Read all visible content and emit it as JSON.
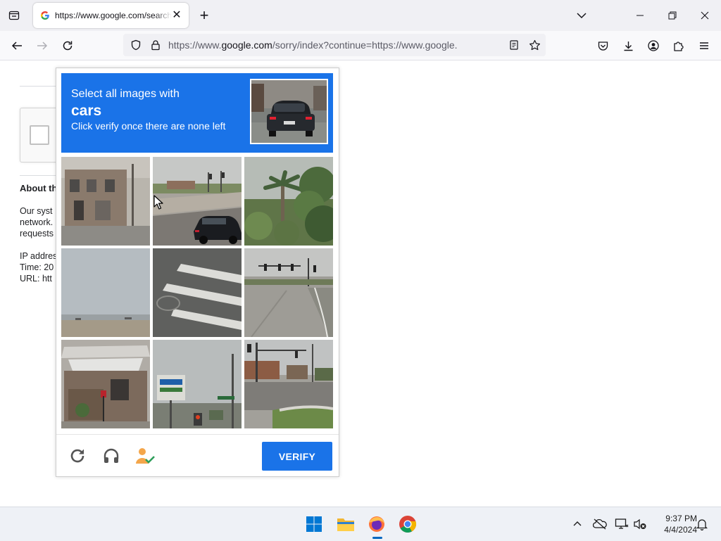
{
  "browser": {
    "tab_title": "https://www.google.com/search?q=",
    "url_prefix": "https://www.",
    "url_domain": "google.com",
    "url_rest": "/sorry/index?continue=https://www.google.com/search"
  },
  "page": {
    "about_title": "About th",
    "about_text": "Our syst\nnetwork.\nrequests",
    "meta_text": "IP addres\nTime: 20\nURL: htt"
  },
  "captcha": {
    "line1": "Select all images with",
    "target": "cars",
    "line3": "Click verify once there are none left",
    "verify_label": "VERIFY",
    "tiles": [
      {
        "name": "tile-building"
      },
      {
        "name": "tile-street-car"
      },
      {
        "name": "tile-palm-trees"
      },
      {
        "name": "tile-sky-horizon"
      },
      {
        "name": "tile-crosswalk"
      },
      {
        "name": "tile-road-traffic-lights"
      },
      {
        "name": "tile-stone-house"
      },
      {
        "name": "tile-street-signs"
      },
      {
        "name": "tile-intersection"
      }
    ]
  },
  "taskbar": {
    "time": "9:37 PM",
    "date": "4/4/2024"
  },
  "colors": {
    "captcha_blue": "#1a73e8",
    "windows_blue": "#0067c0"
  }
}
